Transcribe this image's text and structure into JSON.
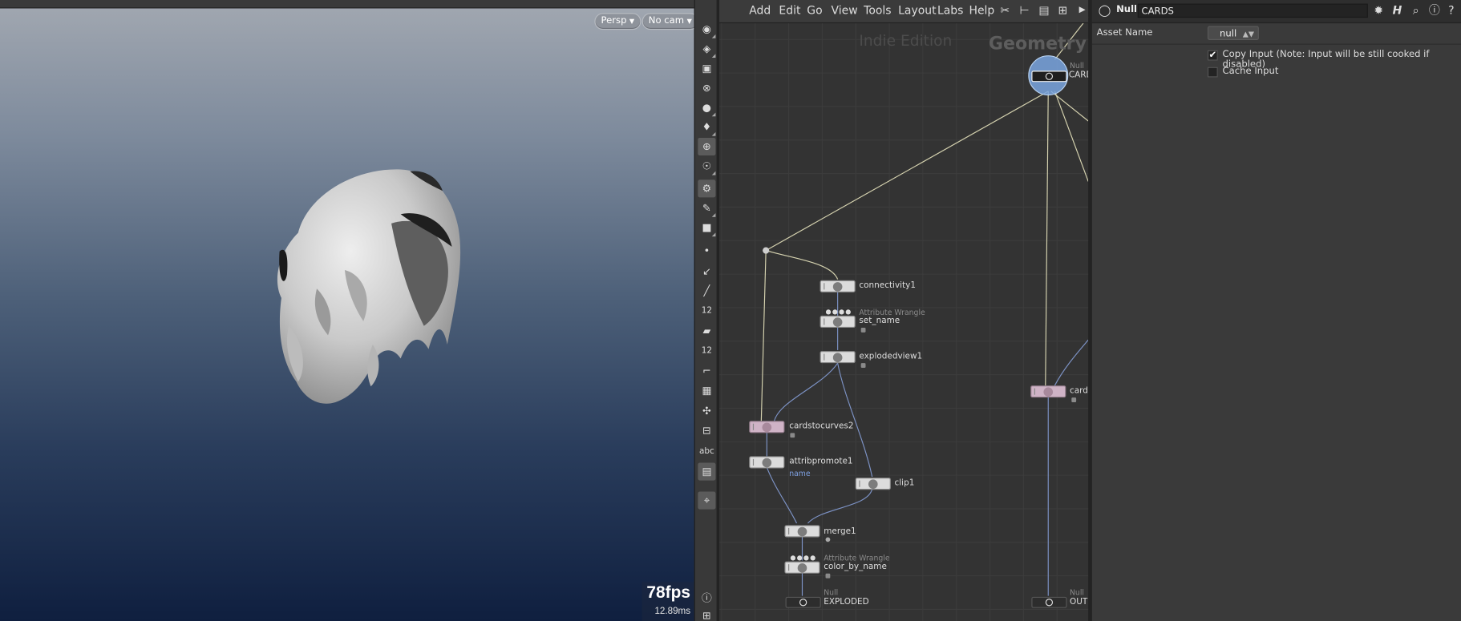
{
  "viewport": {
    "camera_view": "Persp",
    "camera": "No cam",
    "fps": "78fps",
    "frame_time": "12.89ms",
    "toolbar_icons": [
      "eye-icon",
      "display-options-icon",
      "lock-icon",
      "wireframe-icon",
      "shading-icon",
      "light-icon",
      "ghost-icon",
      "skeleton-icon",
      "camera-icon",
      "snap-icon",
      "render-icon",
      "point-icon",
      "normal-icon",
      "brush-icon",
      "point-number-icon",
      "paint-icon",
      "prim-number-icon",
      "corner-icon",
      "grid-icon",
      "handle-icon",
      "stop-icon",
      "text-icon",
      "background-icon",
      "pin-icon",
      "info-icon",
      "layout-icon"
    ],
    "toolbar_text_labels": {
      "point_number": "12",
      "prim_number": "12",
      "text_toggle": "abc"
    }
  },
  "network": {
    "menu": [
      "Add",
      "Edit",
      "Go",
      "View",
      "Tools",
      "Layout",
      "Labs",
      "Help"
    ],
    "edition_label": "Indie Edition",
    "context_label": "Geometry",
    "nodes": {
      "cards_top": {
        "type": "Null",
        "name": "CARD"
      },
      "connectivity": {
        "name": "connectivity1"
      },
      "set_name": {
        "type": "Attribute Wrangle",
        "name": "set_name"
      },
      "explodedview": {
        "name": "explodedview1"
      },
      "cardstocurves": {
        "name": "cardstocurves2"
      },
      "attribpromote": {
        "name": "attribpromote1",
        "comment": "name"
      },
      "clip": {
        "name": "clip1"
      },
      "merge": {
        "name": "merge1"
      },
      "color_by_name": {
        "type": "Attribute Wrangle",
        "name": "color_by_name"
      },
      "exploded": {
        "type": "Null",
        "name": "EXPLODED"
      },
      "cards_right": {
        "name": "cards"
      },
      "out": {
        "type": "Null",
        "name": "OUT"
      }
    }
  },
  "params": {
    "node_type": "Null",
    "node_name": "CARDS",
    "asset_name_label": "Asset Name",
    "asset_name_value": "null",
    "copy_input_label": "Copy Input (Note: Input will be still cooked if disabled)",
    "copy_input_checked": "✔",
    "cache_input_label": "Cache Input"
  },
  "colors": {
    "viewport_top": "#a2a8b1",
    "viewport_bottom": "#0f1f3f",
    "wire_light": "#d6d3b0",
    "wire_blue": "#7d93c6",
    "node_pink": "#cfb3c6",
    "selected_halo": "#7aa6e0"
  }
}
